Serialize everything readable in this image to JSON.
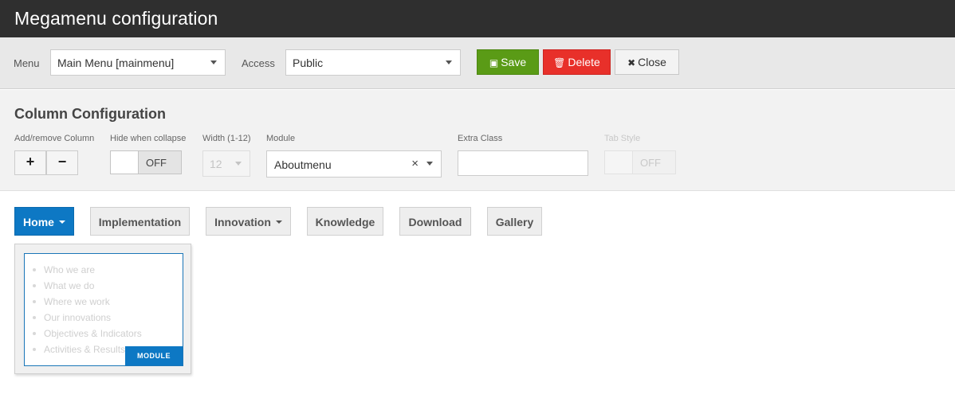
{
  "header": {
    "title": "Megamenu configuration"
  },
  "toolbar": {
    "menu_label": "Menu",
    "menu_value": "Main Menu [mainmenu]",
    "access_label": "Access",
    "access_value": "Public",
    "save_label": "Save",
    "delete_label": "Delete",
    "close_label": "Close",
    "colors": {
      "save": "#5a9b16",
      "delete": "#e8302a",
      "close": "#f3f3f3"
    }
  },
  "column_config": {
    "title": "Column Configuration",
    "add_remove_label": "Add/remove Column",
    "add_symbol": "+",
    "remove_symbol": "−",
    "hide_collapse_label": "Hide when collapse",
    "hide_collapse_state": "OFF",
    "width_label": "Width (1-12)",
    "width_value": "12",
    "module_label": "Module",
    "module_value": "Aboutmenu",
    "module_clear": "×",
    "extra_class_label": "Extra Class",
    "extra_class_value": "",
    "tab_style_label": "Tab Style",
    "tab_style_state": "OFF"
  },
  "nav": {
    "items": [
      {
        "label": "Home",
        "active": true,
        "has_dropdown": true
      },
      {
        "label": "Implementation",
        "active": false,
        "has_dropdown": false
      },
      {
        "label": "Innovation",
        "active": false,
        "has_dropdown": true
      },
      {
        "label": "Knowledge",
        "active": false,
        "has_dropdown": false
      },
      {
        "label": "Download",
        "active": false,
        "has_dropdown": false
      },
      {
        "label": "Gallery",
        "active": false,
        "has_dropdown": false
      }
    ],
    "accent": "#0d78c4"
  },
  "dropdown": {
    "module_tag": "MODULE",
    "items": [
      "Who we are",
      "What we do",
      "Where we work",
      "Our innovations",
      "Objectives & Indicators",
      "Activities & Results"
    ]
  }
}
